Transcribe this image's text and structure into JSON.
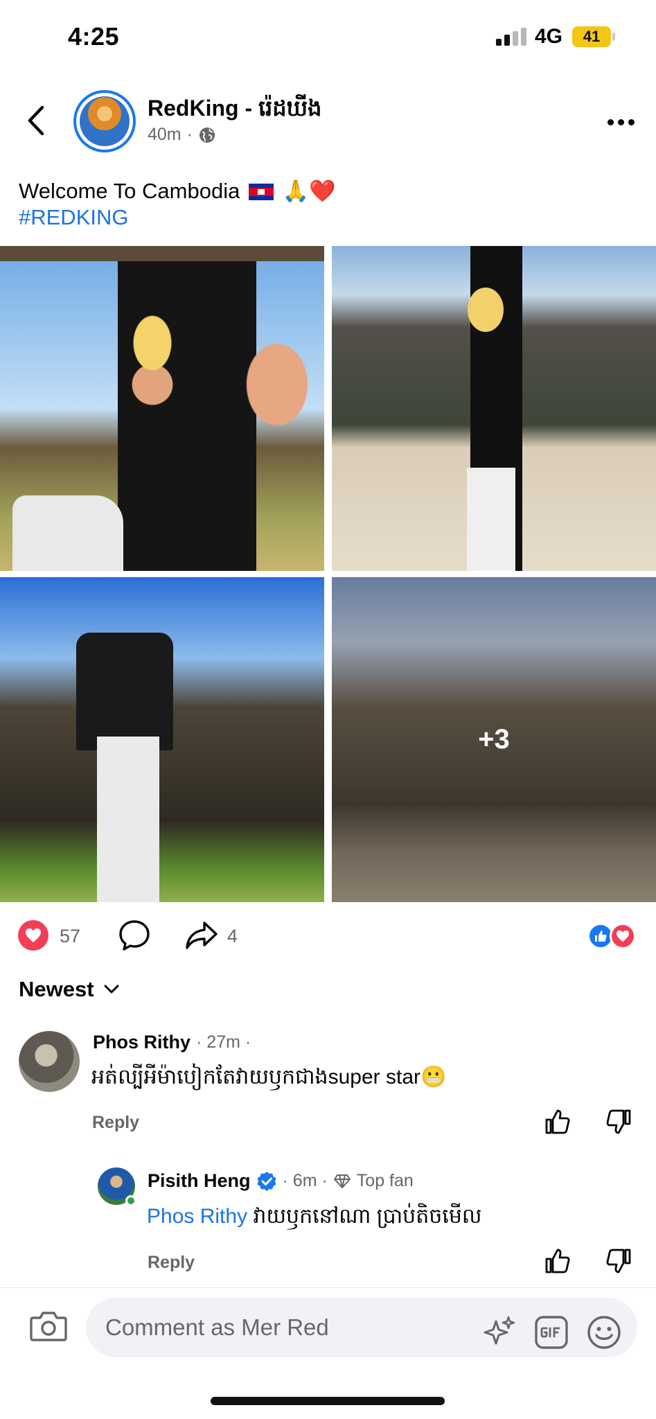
{
  "status_bar": {
    "time": "4:25",
    "network": "4G",
    "battery": "41"
  },
  "post": {
    "page_name": "RedKing - រ៉េដឃីង",
    "time": "40m",
    "separator": "·",
    "caption_text": "Welcome To Cambodia",
    "caption_emojis": "🙏❤️",
    "hashtag": "#REDKING",
    "more_photos": "+3",
    "reaction_count": "57",
    "share_count": "4"
  },
  "comments_section": {
    "sort_label": "Newest",
    "comments": [
      {
        "author": "Phos Rithy",
        "meta": "· 27m ·",
        "text": "អត់ល្បីអីម៉ាបៀកតែវាយឫកជាងsuper star😬",
        "reply_label": "Reply"
      },
      {
        "author": "Pisith Heng",
        "time": "· 6m ·",
        "badge": "Top fan",
        "mention": "Phos Rithy",
        "text": "វាយឫកនៅណា ប្រាប់តិចមើល",
        "reply_label": "Reply"
      }
    ]
  },
  "composer": {
    "placeholder": "Comment as Mer Red"
  },
  "colors": {
    "accent": "#1b74e4",
    "love": "#f33e58",
    "like": "#1877f2",
    "meta": "#65676b"
  }
}
